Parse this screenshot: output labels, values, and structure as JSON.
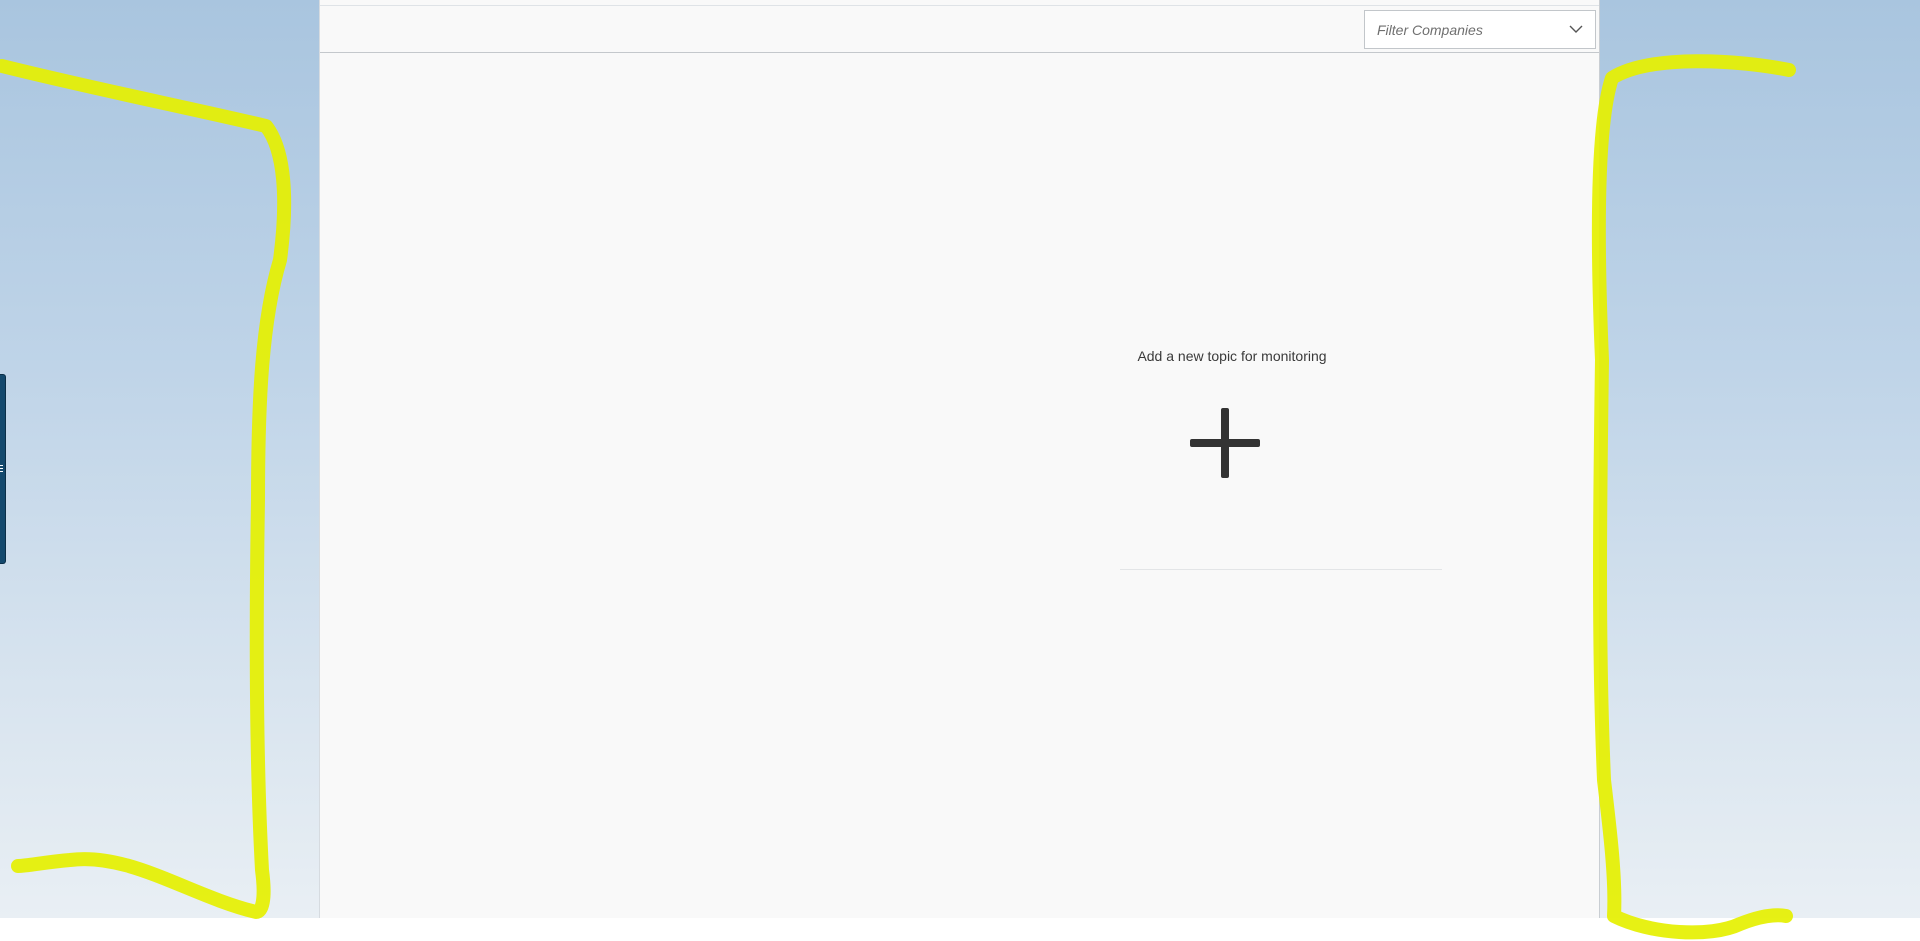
{
  "toolbar": {
    "filter": {
      "placeholder": "Filter Companies"
    }
  },
  "empty_state": {
    "message": "Add a new topic for monitoring",
    "add_icon": "plus-icon"
  },
  "colors": {
    "annotation_stroke": "#e5f000",
    "side_tab": "#14496d",
    "panel_background": "#f9f9f9",
    "plus_icon": "#333333"
  }
}
